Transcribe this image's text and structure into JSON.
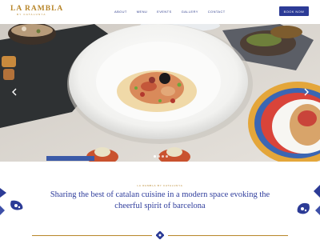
{
  "brand": {
    "name": "LA RAMBLA",
    "tagline": "BY CATALUNYA",
    "accent_color": "#b8862a",
    "primary_color": "#2c3b96"
  },
  "nav": {
    "items": [
      {
        "label": "ABOUT"
      },
      {
        "label": "MENU"
      },
      {
        "label": "EVENTS"
      },
      {
        "label": "GALLERY"
      },
      {
        "label": "CONTACT"
      }
    ],
    "book_label": "BOOK NOW"
  },
  "hero": {
    "image": "plated-octopus-dish-icon",
    "prev_icon": "chevron-left-icon",
    "next_icon": "chevron-right-icon",
    "slides_count": 4,
    "active_slide": 1
  },
  "intro": {
    "kicker": "LA RAMBLA BY CATALUNYA",
    "headline": "Sharing the best of catalan cuisine in a modern space evoking the cheerful spirit of barcelona"
  }
}
